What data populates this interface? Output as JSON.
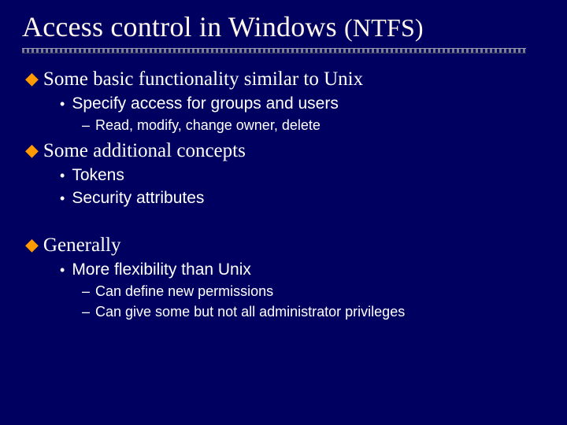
{
  "title_main": "Access control in Windows ",
  "title_sub": "(NTFS)",
  "sections": [
    {
      "heading": "Some basic functionality similar to Unix",
      "items": [
        {
          "text": "Specify access for groups and users",
          "subitems": [
            "Read, modify, change owner, delete"
          ]
        }
      ]
    },
    {
      "heading": "Some additional concepts",
      "items": [
        {
          "text": "Tokens",
          "subitems": []
        },
        {
          "text": "Security attributes",
          "subitems": []
        }
      ]
    },
    {
      "heading": "Generally",
      "items": [
        {
          "text": "More flexibility than Unix",
          "subitems": [
            "Can define new permissions",
            "Can give some but not all administrator privileges"
          ]
        }
      ]
    }
  ]
}
